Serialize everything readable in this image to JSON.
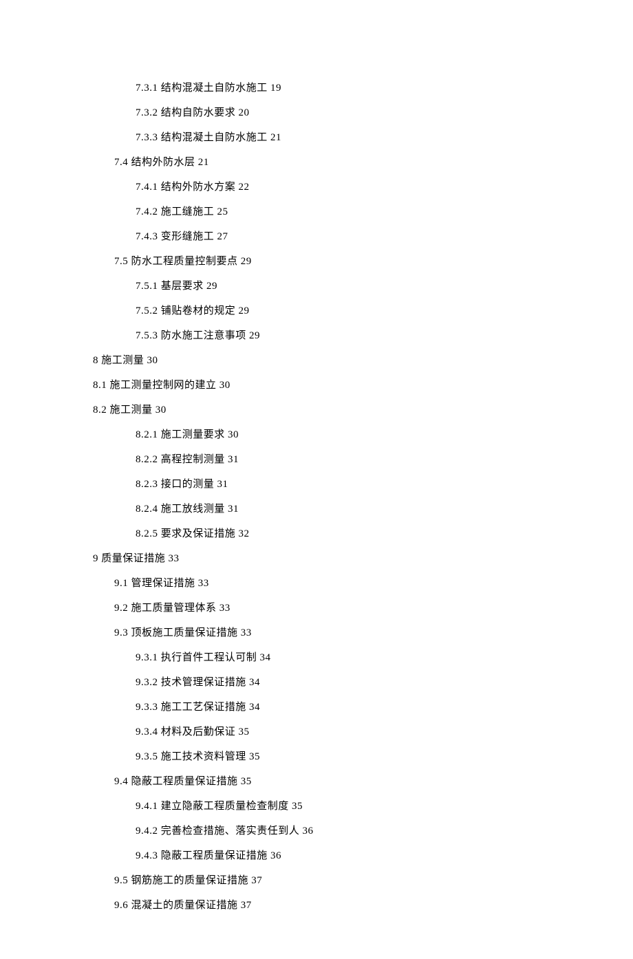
{
  "toc": [
    {
      "indent": 2,
      "num": "7.3.1",
      "title": "结构混凝土自防水施工",
      "page": "19"
    },
    {
      "indent": 2,
      "num": "7.3.2",
      "title": "结构自防水要求",
      "page": "20"
    },
    {
      "indent": 2,
      "num": "7.3.3",
      "title": "结构混凝土自防水施工",
      "page": "21"
    },
    {
      "indent": 1,
      "num": "7.4",
      "title": "结构外防水层",
      "page": "21"
    },
    {
      "indent": 2,
      "num": "7.4.1",
      "title": "结构外防水方案",
      "page": "22"
    },
    {
      "indent": 2,
      "num": "7.4.2",
      "title": "施工缝施工",
      "page": "25"
    },
    {
      "indent": 2,
      "num": "7.4.3",
      "title": "变形缝施工",
      "page": "27"
    },
    {
      "indent": 1,
      "num": "7.5",
      "title": "防水工程质量控制要点",
      "page": "29"
    },
    {
      "indent": 2,
      "num": "7.5.1",
      "title": "基层要求",
      "page": "29"
    },
    {
      "indent": 2,
      "num": "7.5.2",
      "title": "铺贴卷材的规定",
      "page": "29"
    },
    {
      "indent": 2,
      "num": "7.5.3",
      "title": "防水施工注意事项",
      "page": "29"
    },
    {
      "indent": 0,
      "num": "8",
      "title": "施工测量",
      "page": "30"
    },
    {
      "indent": 0,
      "num": "8.1",
      "title": "施工测量控制网的建立",
      "page": "30"
    },
    {
      "indent": 0,
      "num": "8.2",
      "title": "施工测量",
      "page": "30"
    },
    {
      "indent": 2,
      "num": "8.2.1",
      "title": "施工测量要求",
      "page": "30"
    },
    {
      "indent": 2,
      "num": "8.2.2",
      "title": "高程控制测量",
      "page": "31"
    },
    {
      "indent": 2,
      "num": "8.2.3",
      "title": "接口的测量",
      "page": "31"
    },
    {
      "indent": 2,
      "num": "8.2.4",
      "title": "施工放线测量",
      "page": "31"
    },
    {
      "indent": 2,
      "num": "8.2.5",
      "title": "要求及保证措施",
      "page": "32"
    },
    {
      "indent": 0,
      "num": "9",
      "title": "质量保证措施",
      "page": "33"
    },
    {
      "indent": 1,
      "num": "9.1",
      "title": "管理保证措施",
      "page": "33"
    },
    {
      "indent": 1,
      "num": "9.2",
      "title": "施工质量管理体系",
      "page": "33"
    },
    {
      "indent": 1,
      "num": "9.3",
      "title": "顶板施工质量保证措施",
      "page": "33"
    },
    {
      "indent": 2,
      "num": "9.3.1",
      "title": "执行首件工程认可制",
      "page": "34"
    },
    {
      "indent": 2,
      "num": "9.3.2",
      "title": "技术管理保证措施",
      "page": "34"
    },
    {
      "indent": 2,
      "num": "9.3.3",
      "title": "施工工艺保证措施",
      "page": "34"
    },
    {
      "indent": 2,
      "num": "9.3.4",
      "title": "材料及后勤保证",
      "page": "35"
    },
    {
      "indent": 2,
      "num": "9.3.5",
      "title": "施工技术资料管理",
      "page": "35"
    },
    {
      "indent": 1,
      "num": "9.4",
      "title": "隐蔽工程质量保证措施",
      "page": "35"
    },
    {
      "indent": 2,
      "num": "9.4.1",
      "title": "建立隐蔽工程质量检查制度",
      "page": "35"
    },
    {
      "indent": 2,
      "num": "9.4.2",
      "title": "完善检查措施、落实责任到人",
      "page": "36"
    },
    {
      "indent": 2,
      "num": "9.4.3",
      "title": "隐蔽工程质量保证措施",
      "page": "36"
    },
    {
      "indent": 1,
      "num": "9.5",
      "title": "钢筋施工的质量保证措施",
      "page": "37"
    },
    {
      "indent": 1,
      "num": "9.6",
      "title": "混凝土的质量保证措施",
      "page": "37"
    }
  ]
}
